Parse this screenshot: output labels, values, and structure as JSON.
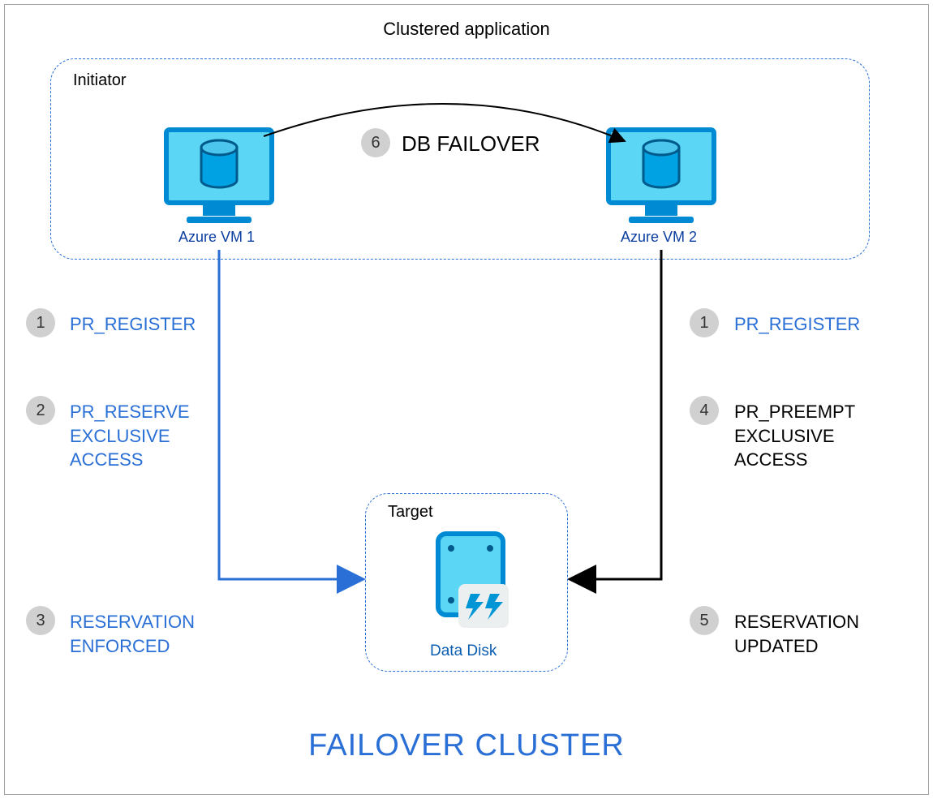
{
  "title": "Clustered application",
  "footer_title": "FAILOVER CLUSTER",
  "initiator": {
    "label": "Initiator"
  },
  "target": {
    "label": "Target",
    "datadisk_label": "Data Disk"
  },
  "vm1": {
    "label": "Azure VM 1"
  },
  "vm2": {
    "label": "Azure VM 2"
  },
  "failover": {
    "label": "DB FAILOVER",
    "badge": "6"
  },
  "steps_left": [
    {
      "num": "1",
      "text": "PR_REGISTER"
    },
    {
      "num": "2",
      "text": "PR_RESERVE\nEXCLUSIVE\nACCESS"
    },
    {
      "num": "3",
      "text": "RESERVATION\nENFORCED"
    }
  ],
  "steps_right": [
    {
      "num": "1",
      "text": "PR_REGISTER"
    },
    {
      "num": "4",
      "text": "PR_PREEMPT\nEXCLUSIVE\nACCESS"
    },
    {
      "num": "5",
      "text": "RESERVATION\nUPDATED"
    }
  ]
}
